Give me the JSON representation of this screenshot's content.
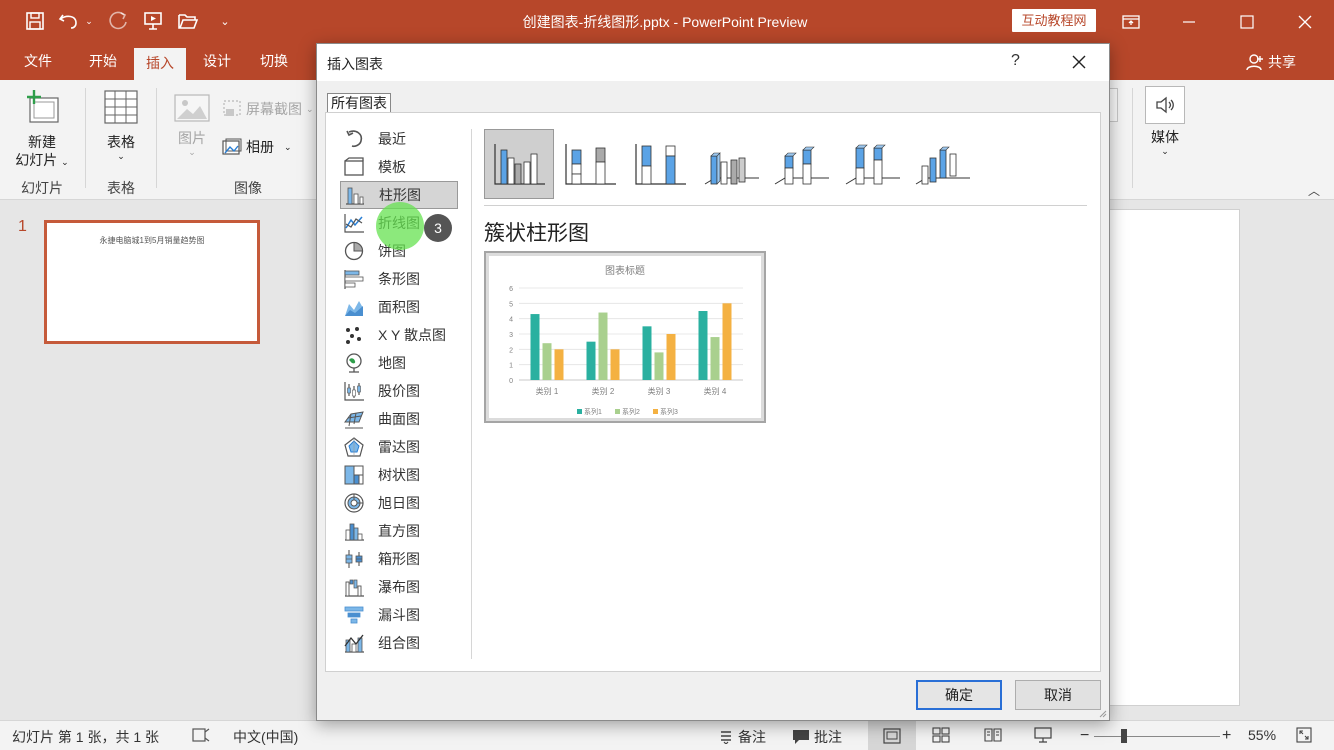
{
  "window": {
    "title": "创建图表-折线图形.pptx  -  PowerPoint Preview",
    "brand_badge": "互动教程网",
    "quick_access": [
      "save-icon",
      "undo-icon",
      "redo-icon",
      "present-icon",
      "open-icon",
      "customize-icon"
    ]
  },
  "ribbon_tabs": [
    "文件",
    "开始",
    "插入",
    "设计",
    "切换"
  ],
  "active_tab": "插入",
  "share_label": "共享",
  "ribbon": {
    "new_slide": "新建\n幻灯片",
    "new_slide_line1": "新建",
    "new_slide_line2": "幻灯片",
    "table": "表格",
    "picture": "图片",
    "screenshot": "屏幕截图",
    "album": "相册",
    "media": "媒体",
    "groups": {
      "slides": "幻灯片",
      "tables": "表格",
      "images": "图像"
    }
  },
  "slides_pane": {
    "slide_number": "1",
    "thumb_title": "永捷电脑城1到5月销量趋势图"
  },
  "dialog": {
    "title": "插入图表",
    "help": "?",
    "tab": "所有图表",
    "categories": [
      {
        "label": "最近",
        "icon": "recent-icon"
      },
      {
        "label": "模板",
        "icon": "template-icon"
      },
      {
        "label": "柱形图",
        "icon": "column-chart-icon"
      },
      {
        "label": "折线图",
        "icon": "line-chart-icon"
      },
      {
        "label": "饼图",
        "icon": "pie-chart-icon"
      },
      {
        "label": "条形图",
        "icon": "bar-chart-icon"
      },
      {
        "label": "面积图",
        "icon": "area-chart-icon"
      },
      {
        "label": "X Y 散点图",
        "icon": "scatter-chart-icon"
      },
      {
        "label": "地图",
        "icon": "map-chart-icon"
      },
      {
        "label": "股价图",
        "icon": "stock-chart-icon"
      },
      {
        "label": "曲面图",
        "icon": "surface-chart-icon"
      },
      {
        "label": "雷达图",
        "icon": "radar-chart-icon"
      },
      {
        "label": "树状图",
        "icon": "treemap-chart-icon"
      },
      {
        "label": "旭日图",
        "icon": "sunburst-chart-icon"
      },
      {
        "label": "直方图",
        "icon": "histogram-chart-icon"
      },
      {
        "label": "箱形图",
        "icon": "box-whisker-chart-icon"
      },
      {
        "label": "瀑布图",
        "icon": "waterfall-chart-icon"
      },
      {
        "label": "漏斗图",
        "icon": "funnel-chart-icon"
      },
      {
        "label": "组合图",
        "icon": "combo-chart-icon"
      }
    ],
    "selected_category": "柱形图",
    "subtypes": [
      "clustered-column",
      "stacked-column",
      "100-stacked-column",
      "3d-clustered-column",
      "3d-stacked-column",
      "3d-100-stacked-column",
      "3d-column"
    ],
    "selected_subtype": "clustered-column",
    "subtype_title": "簇状柱形图",
    "ok_label": "确定",
    "cancel_label": "取消"
  },
  "step_badge": "3",
  "chart_data": {
    "type": "bar",
    "title": "图表标题",
    "categories": [
      "类别 1",
      "类别 2",
      "类别 3",
      "类别 4"
    ],
    "series": [
      {
        "name": "系列1",
        "values": [
          4.3,
          2.5,
          3.5,
          4.5
        ],
        "color": "#2ab0a0"
      },
      {
        "name": "系列2",
        "values": [
          2.4,
          4.4,
          1.8,
          2.8
        ],
        "color": "#a9d08e"
      },
      {
        "name": "系列3",
        "values": [
          2.0,
          2.0,
          3.0,
          5.0
        ],
        "color": "#f4b142"
      }
    ],
    "ylim": [
      0,
      6
    ],
    "yticks": [
      0,
      1,
      2,
      3,
      4,
      5,
      6
    ],
    "legend": "bottom",
    "grid": true
  },
  "status_bar": {
    "slide_info": "幻灯片 第 1 张，共 1 张",
    "language": "中文(中国)",
    "notes": "备注",
    "comments": "批注",
    "zoom": "55%"
  },
  "colors": {
    "accent": "#b7472a",
    "ribbon_bg": "#f3f3f3",
    "dialog_bg": "#f0f0f0",
    "highlight": "#66e250"
  }
}
